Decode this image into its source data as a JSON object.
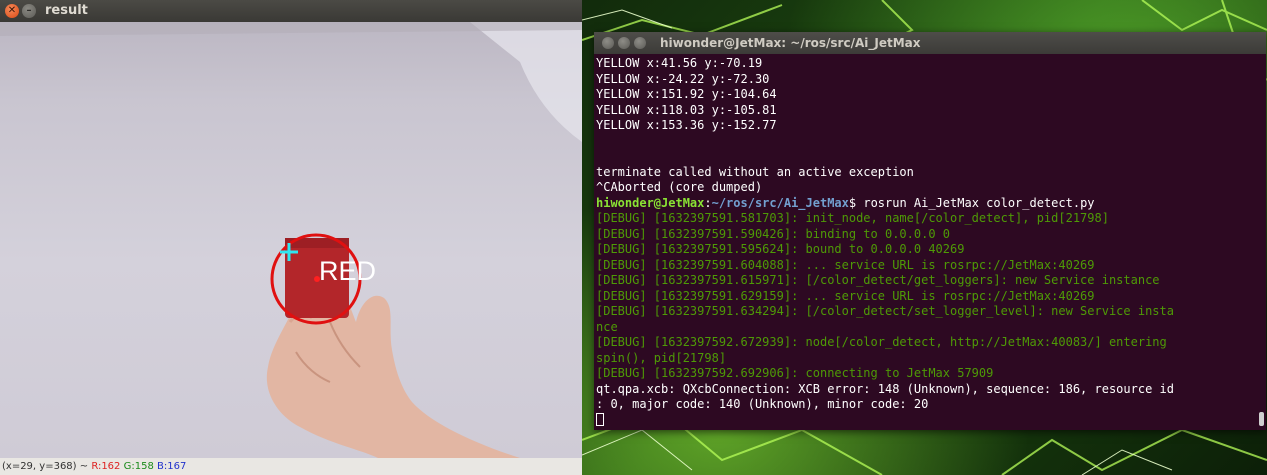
{
  "result_window": {
    "title": "result",
    "detection_label": "RED",
    "status": {
      "coords": "(x=29, y=368) ~ ",
      "r": "R:162",
      "g": "G:158",
      "b": "B:167"
    }
  },
  "terminal": {
    "title": "hiwonder@JetMax: ~/ros/src/Ai_JetMax",
    "lines_top": [
      "YELLOW x:41.56 y:-70.19",
      "YELLOW x:-24.22 y:-72.30",
      "YELLOW x:151.92 y:-104.64",
      "YELLOW x:118.03 y:-105.81",
      "YELLOW x:153.36 y:-152.77",
      "",
      "",
      "terminate called without an active exception",
      "^CAborted (core dumped)"
    ],
    "prompt": {
      "user": "hiwonder@JetMax",
      "sep": ":",
      "path": "~/ros/src/Ai_JetMax",
      "command": "$ rosrun Ai_JetMax color_detect.py"
    },
    "debug_lines": [
      "[DEBUG] [1632397591.581703]: init_node, name[/color_detect], pid[21798]",
      "[DEBUG] [1632397591.590426]: binding to 0.0.0.0 0",
      "[DEBUG] [1632397591.595624]: bound to 0.0.0.0 40269",
      "[DEBUG] [1632397591.604088]: ... service URL is rosrpc://JetMax:40269",
      "[DEBUG] [1632397591.615971]: [/color_detect/get_loggers]: new Service instance",
      "[DEBUG] [1632397591.629159]: ... service URL is rosrpc://JetMax:40269",
      "[DEBUG] [1632397591.634294]: [/color_detect/set_logger_level]: new Service insta",
      "nce",
      "[DEBUG] [1632397592.672939]: node[/color_detect, http://JetMax:40083/] entering",
      "spin(), pid[21798]",
      "[DEBUG] [1632397592.692906]: connecting to JetMax 57909"
    ],
    "error_lines": [
      "qt.qpa.xcb: QXcbConnection: XCB error: 148 (Unknown), sequence: 186, resource id",
      ": 0, major code: 140 (Unknown), minor code: 20"
    ]
  },
  "colors": {
    "terminal_bg": "#2d0922",
    "debug_green": "#4e9a06",
    "prompt_green": "#8ae234",
    "prompt_blue": "#729fcf",
    "detection_circle": "#e01010",
    "crosshair": "#2ee6f0"
  }
}
